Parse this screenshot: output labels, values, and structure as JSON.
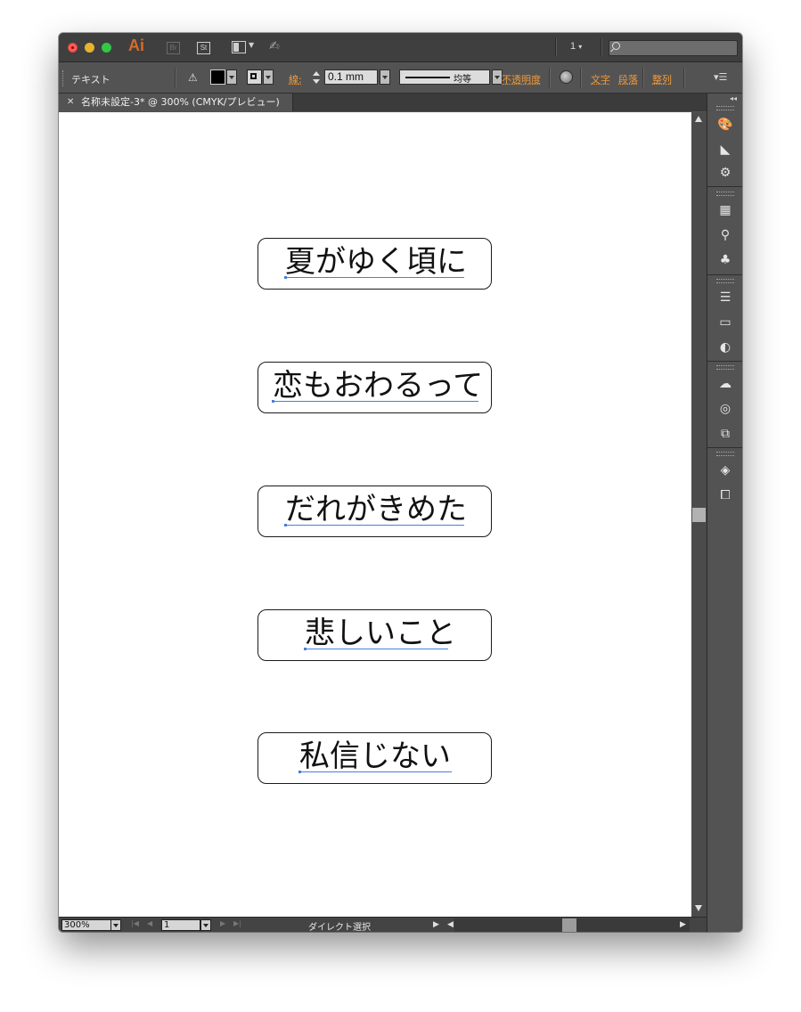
{
  "app": {
    "logo": "Ai",
    "bridge_label": "Br",
    "stock_label": "St",
    "page_indicator": "1",
    "search_placeholder": ""
  },
  "controlbar": {
    "tool_label": "テキスト",
    "stroke_label": "線",
    "stroke_value": "0.1 mm",
    "stroke_style_label": "均等",
    "opacity_label": "不透明度",
    "character_label": "文字",
    "paragraph_label": "段落",
    "align_label": "整列",
    "fill_color": "#000000"
  },
  "document": {
    "tab_title": "名称未設定-3* @ 300% (CMYK/プレビュー)"
  },
  "canvas": {
    "frames": [
      {
        "text": "夏がゆく頃に"
      },
      {
        "text": "恋もおわるって"
      },
      {
        "text": "だれがきめた"
      },
      {
        "text": "悲しいこと"
      },
      {
        "text": "私信じない"
      }
    ]
  },
  "statusbar": {
    "zoom": "300%",
    "page": "1",
    "current_tool": "ダイレクト選択"
  },
  "colors": {
    "accent": "#ef9a3a",
    "baseline": "#4a7fd8",
    "panel_bg": "#535353"
  }
}
